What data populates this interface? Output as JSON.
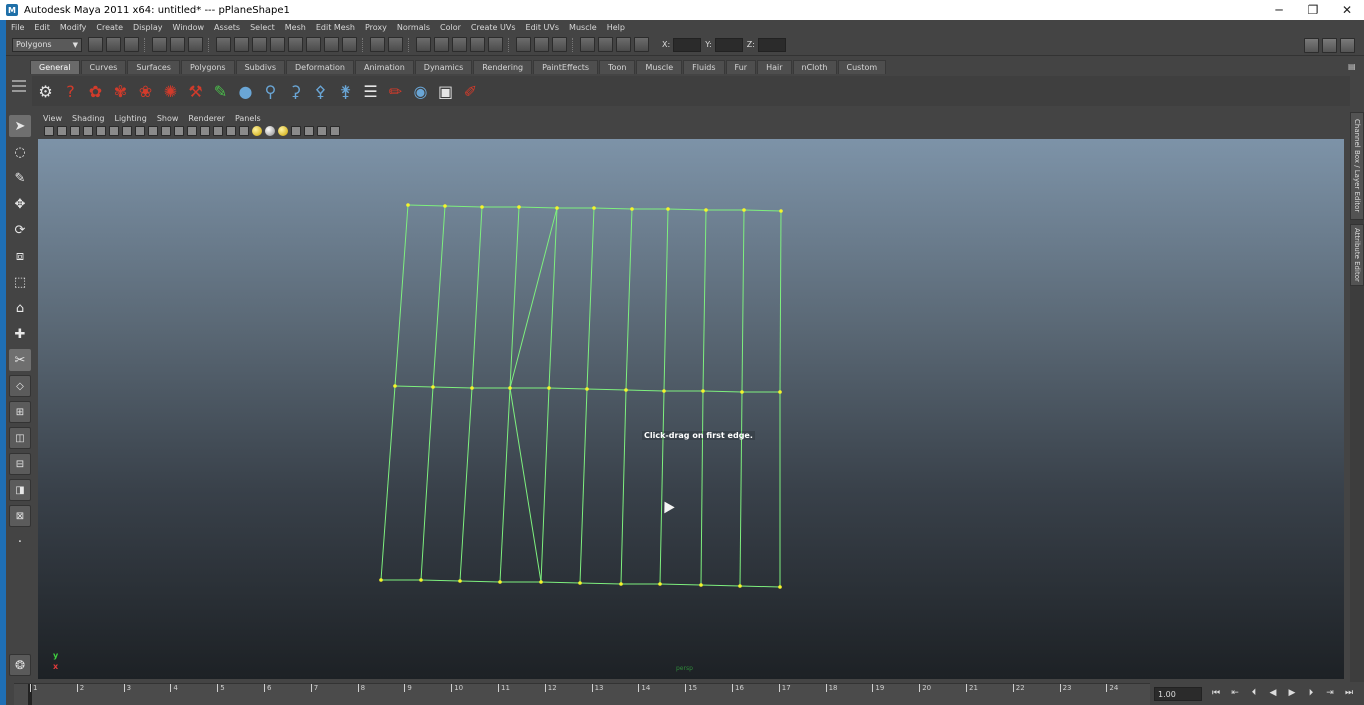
{
  "window": {
    "title": "Autodesk Maya 2011 x64: untitled*   ---   pPlaneShape1",
    "app_icon": "maya-icon",
    "minimize": "─",
    "restore": "❐",
    "close": "✕"
  },
  "menubar": {
    "items": [
      "File",
      "Edit",
      "Modify",
      "Create",
      "Display",
      "Window",
      "Assets",
      "Select",
      "Mesh",
      "Edit Mesh",
      "Proxy",
      "Normals",
      "Color",
      "Create UVs",
      "Edit UVs",
      "Muscle",
      "Help"
    ]
  },
  "statusline": {
    "mode": "Polygons",
    "x_label": "X:",
    "y_label": "Y:",
    "z_label": "Z:",
    "x_value": "",
    "y_value": "",
    "z_value": ""
  },
  "shelf": {
    "tabs": [
      "General",
      "Curves",
      "Surfaces",
      "Polygons",
      "Subdivs",
      "Deformation",
      "Animation",
      "Dynamics",
      "Rendering",
      "PaintEffects",
      "Toon",
      "Muscle",
      "Fluids",
      "Fur",
      "Hair",
      "nCloth",
      "Custom"
    ],
    "active_tab": "General"
  },
  "panel": {
    "menus": [
      "View",
      "Shading",
      "Lighting",
      "Show",
      "Renderer",
      "Panels"
    ]
  },
  "viewport": {
    "hud_message": "Click-drag on first edge.",
    "axis_y": "y",
    "axis_x": "x",
    "camera_label": "persp",
    "wire_color": "#7ef07e",
    "vertex_color": "#f5f52a"
  },
  "right_tabs": {
    "channel_box": "Channel Box / Layer Editor",
    "attribute_editor": "Attribute Editor"
  },
  "timeslider": {
    "ticks": [
      "1",
      "2",
      "3",
      "4",
      "5",
      "6",
      "7",
      "8",
      "9",
      "10",
      "11",
      "12",
      "13",
      "14",
      "15",
      "16",
      "17",
      "18",
      "19",
      "20",
      "21",
      "22",
      "23",
      "24"
    ],
    "current_time": "1.00"
  }
}
